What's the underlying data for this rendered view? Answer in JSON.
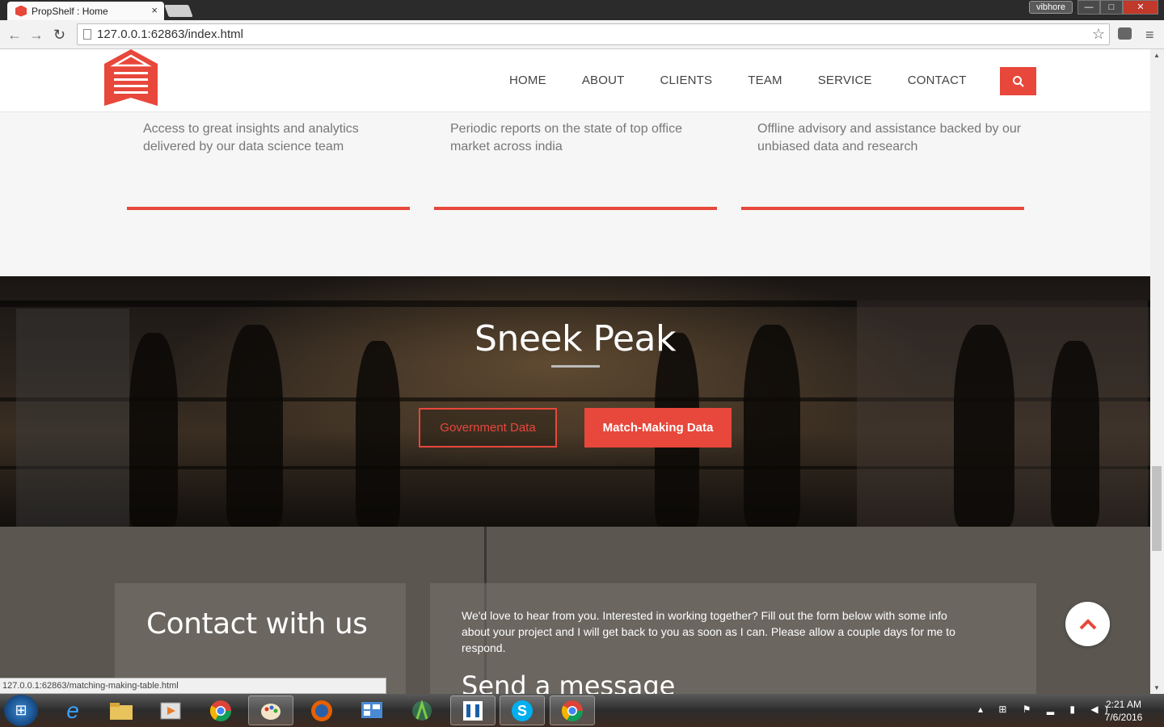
{
  "browser": {
    "tab_title": "PropShelf : Home",
    "tab_close": "×",
    "user_name": "vibhore",
    "window_min": "—",
    "window_max": "□",
    "window_close": "✕",
    "url": "127.0.0.1:62863/index.html",
    "status_url": "127.0.0.1:62863/matching-making-table.html"
  },
  "header": {
    "nav": [
      "HOME",
      "ABOUT",
      "CLIENTS",
      "TEAM",
      "SERVICE",
      "CONTACT"
    ],
    "accent_color": "#e8473b"
  },
  "features": [
    {
      "text": "Access to great insights and analytics delivered by our data science team"
    },
    {
      "text": "Periodic reports on the state of top office market across india"
    },
    {
      "text": "Offline advisory and assistance backed by our unbiased data and research"
    }
  ],
  "sneak": {
    "title": "Sneek Peak",
    "btn_government": "Government Data",
    "btn_matchmaking": "Match-Making Data"
  },
  "contact": {
    "title": "Contact with us",
    "intro": "We'd love to hear from you. Interested in working together? Fill out the form below with some info about your project and I will get back to you as soon as I can. Please allow a couple days for me to respond.",
    "form_title": "Send a message"
  },
  "taskbar": {
    "time": "2:21 AM",
    "date": "7/6/2016"
  }
}
